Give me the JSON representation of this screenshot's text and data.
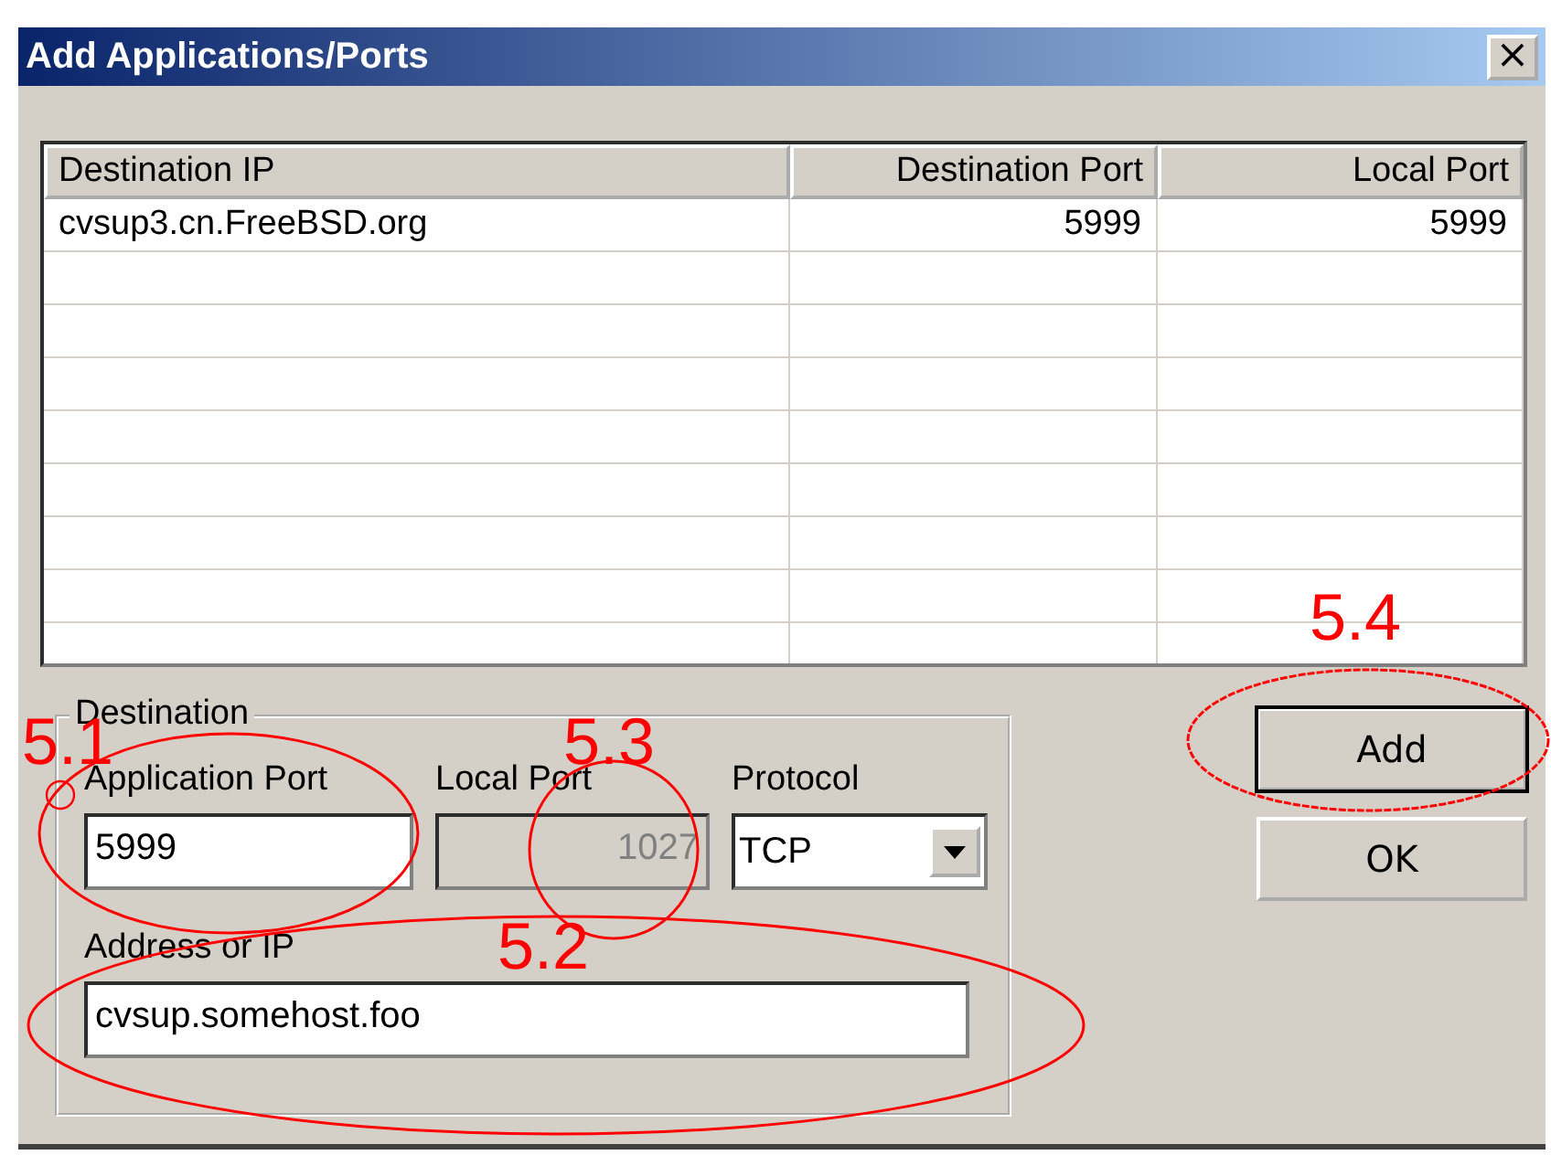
{
  "window": {
    "title": "Add Applications/Ports",
    "close": "×"
  },
  "table": {
    "columns": [
      "Destination IP",
      "Destination Port",
      "Local Port"
    ],
    "rows": [
      {
        "cells": [
          "cvsup3.cn.FreeBSD.org",
          "5999",
          "5999"
        ],
        "selected": false
      }
    ]
  },
  "destination": {
    "title": "Destination",
    "fields": [
      {
        "kind": "text",
        "label": "Application Port",
        "value": "5999",
        "disabled": false
      },
      {
        "kind": "text",
        "label": "Local Port",
        "value": "1027",
        "disabled": true
      },
      {
        "kind": "combo",
        "label": "Protocol",
        "value": "TCP",
        "disabled": false
      },
      {
        "kind": "text",
        "label": "Address or IP",
        "value": "cvsup.somehost.foo",
        "disabled": false
      }
    ]
  },
  "buttons": [
    {
      "label": "Add",
      "default": true
    },
    {
      "label": "OK",
      "default": false
    }
  ],
  "annotations": [
    {
      "label": "5.1"
    },
    {
      "label": "5.3"
    },
    {
      "label": "5.2"
    },
    {
      "label": "5.4"
    }
  ]
}
